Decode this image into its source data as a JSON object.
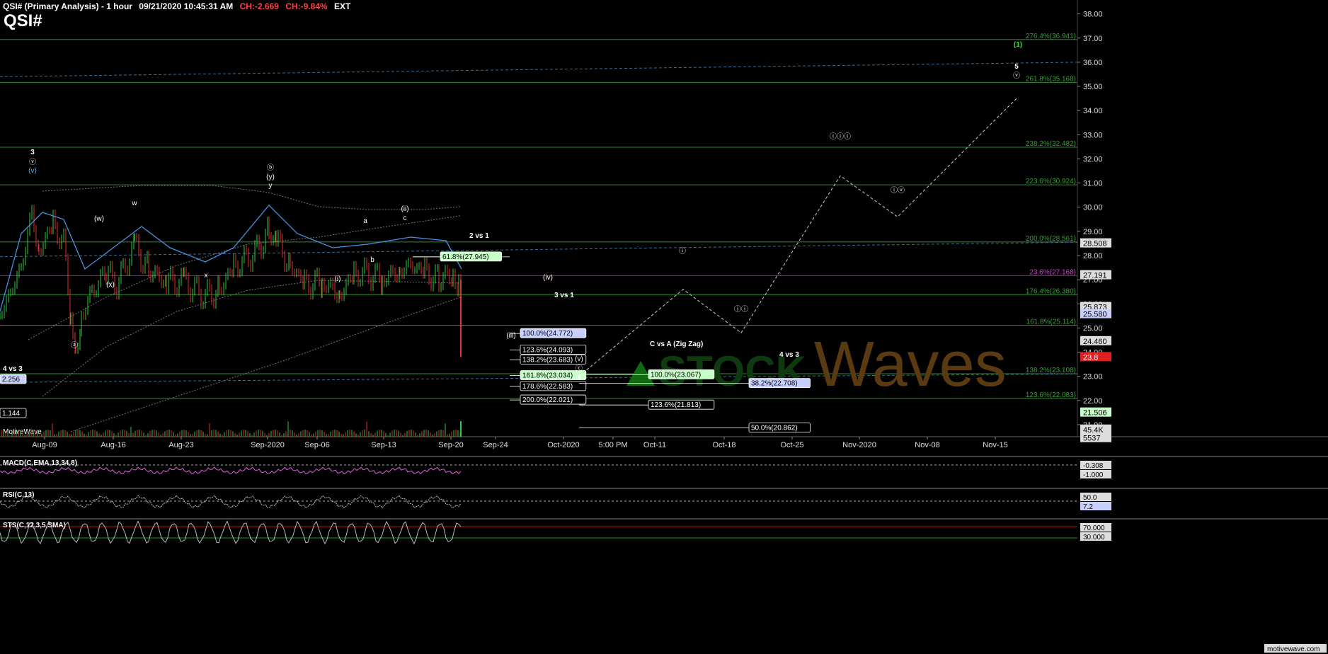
{
  "header": {
    "title": "QSI# (Primary Analysis) - 1 hour",
    "datetime": "09/21/2020 10:45:31 AM",
    "change": "CH:-2.669",
    "change_pct": "CH:-9.84%",
    "session": "EXT",
    "symbol": "QSI#"
  },
  "colors": {
    "background": "#000000",
    "fib_line": "#2e8b2e",
    "fib_label": "#3c9b3c",
    "dashed_blue": "#3a6f9a",
    "magenta": "#c000c0",
    "candle_up": "#2ecc40",
    "candle_down": "#e03030",
    "ma_blue": "#4a90e2",
    "ma_gray": "#777777",
    "price_box": "#c8d0ff",
    "green_box": "#c8ffc8",
    "last_price": "#e02020"
  },
  "chart_data": {
    "type": "candlestick",
    "symbol": "QSI#",
    "timeframe": "1 hour",
    "ylim": [
      20.5,
      38.4
    ],
    "y_ticks": [
      "38.00",
      "37.00",
      "36.00",
      "35.00",
      "34.00",
      "33.00",
      "32.00",
      "31.00",
      "30.00",
      "29.00",
      "28.00",
      "27.00",
      "26.00",
      "25.00",
      "24.00",
      "23.00",
      "22.00",
      "21.00"
    ],
    "x_ticks": [
      "Aug-09",
      "Aug-16",
      "Aug-23",
      "Sep-2020",
      "Sep-06",
      "Sep-13",
      "Sep-20",
      "Sep-24",
      "Oct-2020",
      "5:00 PM",
      "Oct-11",
      "Oct-18",
      "Oct-25",
      "Nov-2020",
      "Nov-08",
      "Nov-15"
    ],
    "price_path": [
      [
        0,
        25.5
      ],
      [
        30,
        27.5
      ],
      [
        45,
        29.8
      ],
      [
        55,
        28.2
      ],
      [
        75,
        29.3
      ],
      [
        90,
        28.5
      ],
      [
        100,
        25.5
      ],
      [
        107,
        24.0
      ],
      [
        115,
        25.5
      ],
      [
        130,
        26.5
      ],
      [
        150,
        27.3
      ],
      [
        165,
        26.8
      ],
      [
        190,
        28.4
      ],
      [
        210,
        27.4
      ],
      [
        235,
        26.9
      ],
      [
        260,
        26.9
      ],
      [
        290,
        26.3
      ],
      [
        310,
        26.6
      ],
      [
        330,
        27.5
      ],
      [
        360,
        28.1
      ],
      [
        380,
        29.0
      ],
      [
        390,
        28.6
      ],
      [
        410,
        27.6
      ],
      [
        430,
        26.8
      ],
      [
        455,
        26.9
      ],
      [
        480,
        26.4
      ],
      [
        500,
        27.2
      ],
      [
        515,
        27.3
      ],
      [
        540,
        27.0
      ],
      [
        565,
        27.4
      ],
      [
        580,
        27.6
      ],
      [
        600,
        27.3
      ],
      [
        620,
        27.0
      ],
      [
        640,
        27.2
      ],
      [
        648,
        26.6
      ],
      [
        652,
        23.8
      ]
    ],
    "last_price": "23.8",
    "right_price_labels": [
      {
        "value": 28.508,
        "label": "28.508",
        "style": "gray"
      },
      {
        "value": 27.191,
        "label": "27.191",
        "style": "gray"
      },
      {
        "value": 25.873,
        "label": "25.873",
        "style": "gray"
      },
      {
        "value": 25.58,
        "label": "25.580",
        "style": "blue"
      },
      {
        "value": 24.46,
        "label": "24.460",
        "style": "gray"
      },
      {
        "value": 21.506,
        "label": "21.506",
        "style": "green"
      },
      {
        "value": 20.8,
        "label": "45.4K",
        "style": "gray"
      },
      {
        "value": 20.45,
        "label": "5537",
        "style": "gray"
      }
    ],
    "fib_levels": [
      {
        "label": "276.4%(36.941)",
        "value": 36.941
      },
      {
        "label": "261.8%(35.168)",
        "value": 35.168
      },
      {
        "label": "238.2%(32.482)",
        "value": 32.482
      },
      {
        "label": "223.6%(30.924)",
        "value": 30.924
      },
      {
        "label": "200.0%(28.561)",
        "value": 28.561
      },
      {
        "label": "23.6%(27.168)",
        "value": 27.168
      },
      {
        "label": "176.4%(26.380)",
        "value": 26.38
      },
      {
        "label": "161.8%(25.114)",
        "value": 25.114
      },
      {
        "label": "138.2%(23.108)",
        "value": 23.108
      },
      {
        "label": "123.6%(22.083)",
        "value": 22.083
      }
    ],
    "retrace_boxes": [
      {
        "label": "61.8%(27.945)",
        "value": 27.945,
        "style": "green"
      },
      {
        "label": "100.0%(24.772)",
        "value": 24.772,
        "style": "blue"
      },
      {
        "label": "123.6%(24.093)",
        "value": 24.093,
        "style": "white"
      },
      {
        "label": "138.2%(23.683)",
        "value": 23.683,
        "style": "white"
      },
      {
        "label": "161.8%(23.034)",
        "value": 23.034,
        "style": "green"
      },
      {
        "label": "178.6%(22.583)",
        "value": 22.583,
        "style": "white"
      },
      {
        "label": "200.0%(22.021)",
        "value": 22.021,
        "style": "white"
      },
      {
        "label": "100.0%(23.067)",
        "value": 23.067,
        "style": "green"
      },
      {
        "label": "38.2%(22.708)",
        "value": 22.708,
        "style": "blue"
      },
      {
        "label": "123.6%(21.813)",
        "value": 21.813,
        "style": "white"
      },
      {
        "label": "50.0%(20.862)",
        "value": 20.862,
        "style": "white"
      }
    ],
    "projection_path": [
      [
        818,
        23.0
      ],
      [
        965,
        26.6
      ],
      [
        1047,
        24.8
      ],
      [
        1187,
        31.3
      ],
      [
        1268,
        29.6
      ],
      [
        1436,
        34.5
      ]
    ],
    "wave_labels": [
      "3",
      "(v)",
      "v",
      "(w)",
      "w",
      "(x)",
      "x",
      "b",
      "(y)",
      "y",
      "a",
      "c",
      "(ii)",
      "(i)",
      "(iii)",
      "(iv)",
      "(v)",
      "ⓐ",
      "ⓑ",
      "ⓒ",
      "4",
      "Ⓘ",
      "Ⓘ",
      "Ⓘ",
      "Ⓘ",
      "Ⓥ",
      "5",
      "(1)"
    ],
    "annotations": [
      "4 vs 3",
      "2.256",
      "1.144",
      "2 vs 1",
      "3 vs 1",
      "C vs A (Zig Zag)",
      "4 vs 3",
      "MotiveWave"
    ],
    "indicators": {
      "macd": {
        "label": "MACD(C,EMA,13,34,8)",
        "values": [
          "-0.308",
          "-1.000"
        ]
      },
      "rsi": {
        "label": "RSI(C,13)",
        "values": [
          "50.0",
          "7.2"
        ]
      },
      "stoch": {
        "label": "STS(C,12,3,5,SMA)",
        "values": [
          "70.000",
          "30.000"
        ]
      }
    },
    "watermark": "StockWaves",
    "footer": "motivewave.com"
  }
}
